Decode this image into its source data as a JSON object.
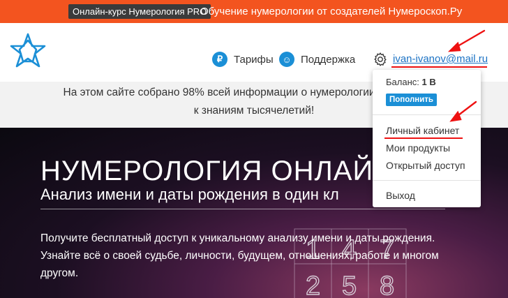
{
  "promo": {
    "badge": "Онлайн-курс Нумерология PRO",
    "text": "Обучение нумерологии от создателей Нумероскоп.Ру"
  },
  "nav": {
    "tariffs": "Тарифы",
    "tariffs_icon_glyph": "₽",
    "support": "Поддержка",
    "support_icon_glyph": "☺",
    "user_email": "ivan-ivanov@mail.ru"
  },
  "info": {
    "line1": "На этом сайте собрано 98% всей информации о нумерологии. Нумеро",
    "line2": "к знаниям тысячелетий!"
  },
  "hero": {
    "title": "НУМЕРОЛОГИЯ ОНЛАЙ",
    "subtitle": "Анализ имени и даты рождения в один кл",
    "desc1": "Получите бесплатный доступ к уникальному анализу имени и даты рождения.",
    "desc2": "Узнайте всё о своей судьбе, личности, будущем, отношениях, работе и многом",
    "desc3": "другом.",
    "grid_numbers": [
      "1",
      "4",
      "7",
      "2",
      "5",
      "8"
    ]
  },
  "dropdown": {
    "balance_label": "Баланс:",
    "balance_value": "1 B",
    "topup": "Пополнить",
    "items": [
      "Личный кабинет",
      "Мои продукты",
      "Открытый доступ"
    ],
    "logout": "Выход"
  },
  "colors": {
    "promo_bg": "#f3541f",
    "accent_blue": "#1b8fd6",
    "annotation_red": "#e11111"
  }
}
